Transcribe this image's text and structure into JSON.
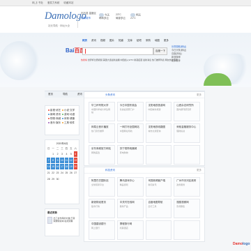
{
  "topbar": {
    "items": [
      "网_訁书社",
      "爱发力系統",
      "收藏本站"
    ]
  },
  "header": {
    "logo": "Damologo",
    "logo_sub": "站长导航 · 网址大全",
    "locations": [
      "石石县 温度区",
      "切换城市"
    ],
    "weather": [
      {
        "day": "今天",
        "desc": "晴转多云",
        "temp": "23°C"
      },
      {
        "day": "明天",
        "desc": "多云转晴",
        "temp": "21°C"
      }
    ],
    "air": [
      "局部多云",
      "空气质量"
    ]
  },
  "search": {
    "tabs": [
      "网页",
      "资讯",
      "视频",
      "图片",
      "知道",
      "文库",
      "贴吧",
      "采购",
      "地图",
      "更多"
    ],
    "engine": [
      "Bai",
      "百度"
    ],
    "button": "百度一下",
    "hot_label": "热搜榜",
    "hot": "世界杯比赛视频 美国大选最新进展 中国加入WTO 新冠疫苗 最新消息 热门推荐列表 网友热议话题",
    "right_links": [
      "乐视视频(网址)",
      "今日头条(网址)",
      "百度(网址)",
      "新浪微博",
      "更多推荐"
    ]
  },
  "nav": {
    "items": [
      "首页",
      "导航",
      "资讯",
      "专题",
      "科技资讯"
    ]
  },
  "sidebar": {
    "categories": [
      {
        "label": "影视·综艺",
        "color": "#e54a3a"
      },
      {
        "label": "小说·文学",
        "color": "#f0a030"
      },
      {
        "label": "新闻·资讯",
        "color": "#3d8fd6"
      },
      {
        "label": "游戏·动漫",
        "color": "#5bb85d"
      },
      {
        "label": "购物·商城",
        "color": "#e54a3a"
      },
      {
        "label": "体育·健康",
        "color": "#3d8fd6"
      },
      {
        "label": "音乐·娱乐",
        "color": "#9b59b6"
      },
      {
        "label": "工具·软件",
        "color": "#f0a030"
      }
    ],
    "calendar": {
      "title": "2020年6月",
      "weekdays": [
        "日",
        "一",
        "二",
        "三",
        "四",
        "五",
        "六"
      ],
      "days": [
        "",
        "1",
        "2",
        "3",
        "4",
        "5",
        "6",
        "7",
        "8",
        "9",
        "10",
        "11",
        "12",
        "13",
        "14",
        "15",
        "16",
        "17",
        "18",
        "19",
        "20",
        "21",
        "22",
        "23",
        "24",
        "25",
        "26",
        "27",
        "28",
        "29",
        "30",
        "",
        "",
        ""
      ]
    },
    "latest": {
      "title": "最近更新",
      "item": "出工会作用的文章(王者荣耀新版本)在线观看"
    }
  },
  "panels": [
    {
      "title": "头条资讯",
      "more": "更多",
      "cards": [
        {
          "t": "华工杯号院大学",
          "s": "中国科学城大学生网站"
        },
        {
          "t": "今日中国冬奥会",
          "s": "冬奥会观赛门户"
        },
        {
          "t": "沈阳地铁旅游网",
          "s": "中国城市旅游"
        },
        {
          "t": "山西杂志研究所",
          "s": "国内期刊研究所"
        },
        {
          "t": "网易云音乐播放",
          "s": "热门音乐推荐"
        },
        {
          "t": "一网打尽全国网站",
          "s": "中国网址导航"
        },
        {
          "t": "沈阳地铁线路图",
          "s": "城市交通查询"
        },
        {
          "t": "蚂蚁金融服务中心",
          "s": "理财投资"
        },
        {
          "t": "京东商城官方网站",
          "s": "网购首选"
        },
        {
          "t": "苏宁易购电器城",
          "s": "家电购物"
        },
        {
          "t": "",
          "s": ""
        },
        {
          "t": "",
          "s": ""
        }
      ]
    },
    {
      "title": "科技资讯",
      "more": "更多",
      "cards": [
        {
          "t": "阿里巴巴国际站",
          "s": "全球贸易平台"
        },
        {
          "t": "腾讯游戏中心",
          "s": "精品游戏"
        },
        {
          "t": "网易新闻客户端",
          "s": "新闻资讯"
        },
        {
          "t": "广州市天河区政府",
          "s": "政务服务"
        },
        {
          "t": "新浪财经首页",
          "s": "股市行情"
        },
        {
          "t": "中关村在线网",
          "s": "数码产品"
        },
        {
          "t": "百度地图导航",
          "s": "出行工具"
        },
        {
          "t": "搜狐视频网",
          "s": "影视剧集"
        },
        {
          "t": "中国建设银行",
          "s": "网上银行"
        },
        {
          "t": "携程旅行网",
          "s": "机票酒店"
        },
        {
          "t": "",
          "s": ""
        },
        {
          "t": "",
          "s": ""
        }
      ]
    }
  ],
  "footer": {
    "logo_a": "Damo",
    "logo_b": "logo"
  }
}
